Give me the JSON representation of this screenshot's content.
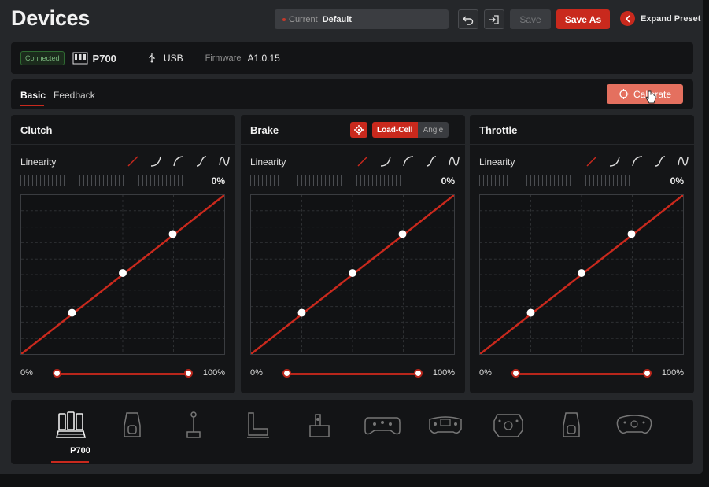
{
  "header": {
    "title": "Devices",
    "preset_label": "Current",
    "preset_value": "Default",
    "save_label": "Save",
    "save_as_label": "Save As",
    "expand_label": "Expand Preset"
  },
  "device": {
    "status": "Connected",
    "name": "P700",
    "connection": "USB",
    "firmware_label": "Firmware",
    "firmware_version": "A1.0.15"
  },
  "tabs": [
    {
      "label": "Basic",
      "active": true
    },
    {
      "label": "Feedback",
      "active": false
    }
  ],
  "calibrate_label": "Calibrate",
  "panels": [
    {
      "title": "Clutch",
      "linearity_label": "Linearity",
      "value": "0%",
      "min_label": "0%",
      "max_label": "100%"
    },
    {
      "title": "Brake",
      "linearity_label": "Linearity",
      "value": "0%",
      "min_label": "0%",
      "max_label": "100%",
      "modes": [
        "Load-Cell",
        "Angle"
      ],
      "active_mode": "Load-Cell"
    },
    {
      "title": "Throttle",
      "linearity_label": "Linearity",
      "value": "0%",
      "min_label": "0%",
      "max_label": "100%"
    }
  ],
  "curve_presets": [
    "linear-icon",
    "exponential-icon",
    "logarithmic-icon",
    "s-curve-icon",
    "wave-curve-icon"
  ],
  "dock": {
    "selected_label": "P700",
    "devices": [
      "pedals-icon",
      "handbrake-icon",
      "shifter-icon",
      "seat-icon",
      "rig-icon",
      "gamepad-wheel-icon",
      "formula-wheel-icon",
      "square-wheel-icon",
      "handbrake-alt-icon",
      "gt-wheel-icon"
    ]
  },
  "colors": {
    "accent": "#c9291d",
    "calibrate": "#e4705f",
    "connected": "#77b27a"
  }
}
